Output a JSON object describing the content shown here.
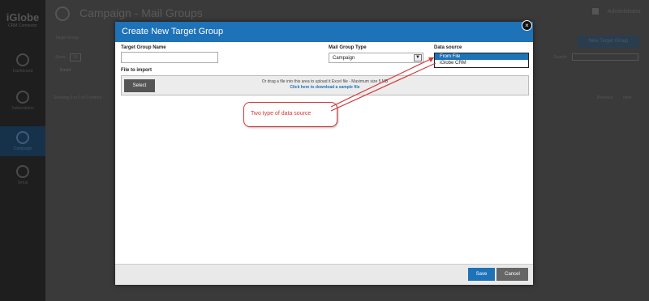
{
  "background_app": {
    "logo": "iGlobe",
    "logo_sub": "CRM Connector",
    "page_title": "Campaign - Mail Groups",
    "user_label": "Administrator",
    "new_group_button": "New Target Group",
    "section_label": "Target Group",
    "show_label": "Show",
    "entries_value": "10",
    "search_label": "Search:",
    "email_header": "Email",
    "showing_text": "Showing 0 to 0 of 0 entries",
    "prev_label": "Previous",
    "next_label": "Next",
    "sidebar": [
      {
        "label": "Dashboard",
        "icon": "dashboard-icon",
        "active": false
      },
      {
        "label": "Subscription",
        "icon": "mail-icon",
        "active": false
      },
      {
        "label": "Campaign",
        "icon": "campaign-icon",
        "active": true
      },
      {
        "label": "Setup",
        "icon": "gear-icon",
        "active": false
      }
    ]
  },
  "modal": {
    "title": "Create New Target Group",
    "close_icon": "×",
    "target_group_name_label": "Target Group Name",
    "target_group_name_value": "",
    "mail_group_type_label": "Mail Group Type",
    "mail_group_type_value": "Campaign",
    "data_source_label": "Data source",
    "data_source_options": [
      "From File",
      "iGlobe CRM"
    ],
    "data_source_selected": "From File",
    "file_to_import_label": "File to import",
    "select_button": "Select",
    "drop_text": "Or drag a file into this area to upload it Excel file - Maximum size 5 MB",
    "sample_link": "Click here to download a sample file",
    "save_button": "Save",
    "cancel_button": "Cancel"
  },
  "annotation": {
    "callout_text": "Two type of data source",
    "color": "#d23a3a"
  },
  "colors": {
    "accent": "#1d72b8",
    "overlay": "#3a3a3a"
  }
}
